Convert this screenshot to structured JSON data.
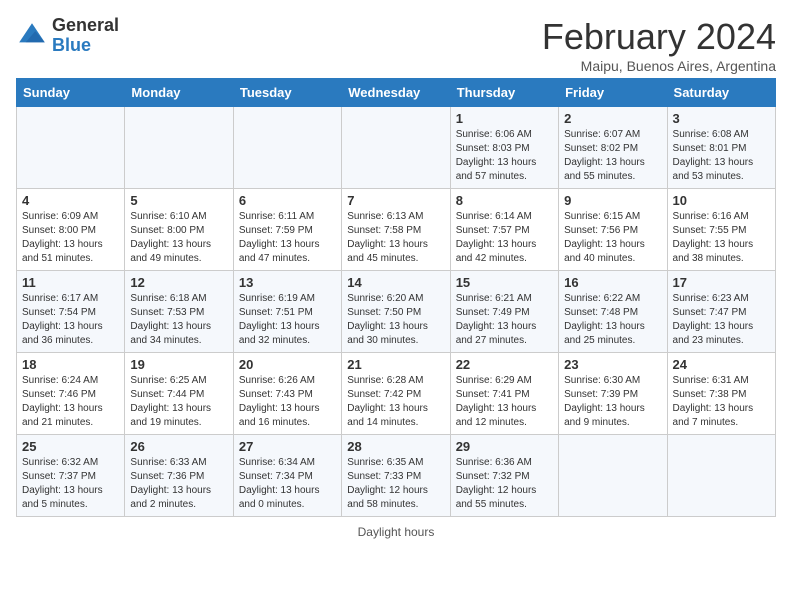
{
  "logo": {
    "general": "General",
    "blue": "Blue"
  },
  "header": {
    "month": "February 2024",
    "location": "Maipu, Buenos Aires, Argentina"
  },
  "columns": [
    "Sunday",
    "Monday",
    "Tuesday",
    "Wednesday",
    "Thursday",
    "Friday",
    "Saturday"
  ],
  "weeks": [
    [
      {
        "day": "",
        "info": ""
      },
      {
        "day": "",
        "info": ""
      },
      {
        "day": "",
        "info": ""
      },
      {
        "day": "",
        "info": ""
      },
      {
        "day": "1",
        "info": "Sunrise: 6:06 AM\nSunset: 8:03 PM\nDaylight: 13 hours\nand 57 minutes."
      },
      {
        "day": "2",
        "info": "Sunrise: 6:07 AM\nSunset: 8:02 PM\nDaylight: 13 hours\nand 55 minutes."
      },
      {
        "day": "3",
        "info": "Sunrise: 6:08 AM\nSunset: 8:01 PM\nDaylight: 13 hours\nand 53 minutes."
      }
    ],
    [
      {
        "day": "4",
        "info": "Sunrise: 6:09 AM\nSunset: 8:00 PM\nDaylight: 13 hours\nand 51 minutes."
      },
      {
        "day": "5",
        "info": "Sunrise: 6:10 AM\nSunset: 8:00 PM\nDaylight: 13 hours\nand 49 minutes."
      },
      {
        "day": "6",
        "info": "Sunrise: 6:11 AM\nSunset: 7:59 PM\nDaylight: 13 hours\nand 47 minutes."
      },
      {
        "day": "7",
        "info": "Sunrise: 6:13 AM\nSunset: 7:58 PM\nDaylight: 13 hours\nand 45 minutes."
      },
      {
        "day": "8",
        "info": "Sunrise: 6:14 AM\nSunset: 7:57 PM\nDaylight: 13 hours\nand 42 minutes."
      },
      {
        "day": "9",
        "info": "Sunrise: 6:15 AM\nSunset: 7:56 PM\nDaylight: 13 hours\nand 40 minutes."
      },
      {
        "day": "10",
        "info": "Sunrise: 6:16 AM\nSunset: 7:55 PM\nDaylight: 13 hours\nand 38 minutes."
      }
    ],
    [
      {
        "day": "11",
        "info": "Sunrise: 6:17 AM\nSunset: 7:54 PM\nDaylight: 13 hours\nand 36 minutes."
      },
      {
        "day": "12",
        "info": "Sunrise: 6:18 AM\nSunset: 7:53 PM\nDaylight: 13 hours\nand 34 minutes."
      },
      {
        "day": "13",
        "info": "Sunrise: 6:19 AM\nSunset: 7:51 PM\nDaylight: 13 hours\nand 32 minutes."
      },
      {
        "day": "14",
        "info": "Sunrise: 6:20 AM\nSunset: 7:50 PM\nDaylight: 13 hours\nand 30 minutes."
      },
      {
        "day": "15",
        "info": "Sunrise: 6:21 AM\nSunset: 7:49 PM\nDaylight: 13 hours\nand 27 minutes."
      },
      {
        "day": "16",
        "info": "Sunrise: 6:22 AM\nSunset: 7:48 PM\nDaylight: 13 hours\nand 25 minutes."
      },
      {
        "day": "17",
        "info": "Sunrise: 6:23 AM\nSunset: 7:47 PM\nDaylight: 13 hours\nand 23 minutes."
      }
    ],
    [
      {
        "day": "18",
        "info": "Sunrise: 6:24 AM\nSunset: 7:46 PM\nDaylight: 13 hours\nand 21 minutes."
      },
      {
        "day": "19",
        "info": "Sunrise: 6:25 AM\nSunset: 7:44 PM\nDaylight: 13 hours\nand 19 minutes."
      },
      {
        "day": "20",
        "info": "Sunrise: 6:26 AM\nSunset: 7:43 PM\nDaylight: 13 hours\nand 16 minutes."
      },
      {
        "day": "21",
        "info": "Sunrise: 6:28 AM\nSunset: 7:42 PM\nDaylight: 13 hours\nand 14 minutes."
      },
      {
        "day": "22",
        "info": "Sunrise: 6:29 AM\nSunset: 7:41 PM\nDaylight: 13 hours\nand 12 minutes."
      },
      {
        "day": "23",
        "info": "Sunrise: 6:30 AM\nSunset: 7:39 PM\nDaylight: 13 hours\nand 9 minutes."
      },
      {
        "day": "24",
        "info": "Sunrise: 6:31 AM\nSunset: 7:38 PM\nDaylight: 13 hours\nand 7 minutes."
      }
    ],
    [
      {
        "day": "25",
        "info": "Sunrise: 6:32 AM\nSunset: 7:37 PM\nDaylight: 13 hours\nand 5 minutes."
      },
      {
        "day": "26",
        "info": "Sunrise: 6:33 AM\nSunset: 7:36 PM\nDaylight: 13 hours\nand 2 minutes."
      },
      {
        "day": "27",
        "info": "Sunrise: 6:34 AM\nSunset: 7:34 PM\nDaylight: 13 hours\nand 0 minutes."
      },
      {
        "day": "28",
        "info": "Sunrise: 6:35 AM\nSunset: 7:33 PM\nDaylight: 12 hours\nand 58 minutes."
      },
      {
        "day": "29",
        "info": "Sunrise: 6:36 AM\nSunset: 7:32 PM\nDaylight: 12 hours\nand 55 minutes."
      },
      {
        "day": "",
        "info": ""
      },
      {
        "day": "",
        "info": ""
      }
    ]
  ],
  "footer": {
    "note": "Daylight hours"
  }
}
